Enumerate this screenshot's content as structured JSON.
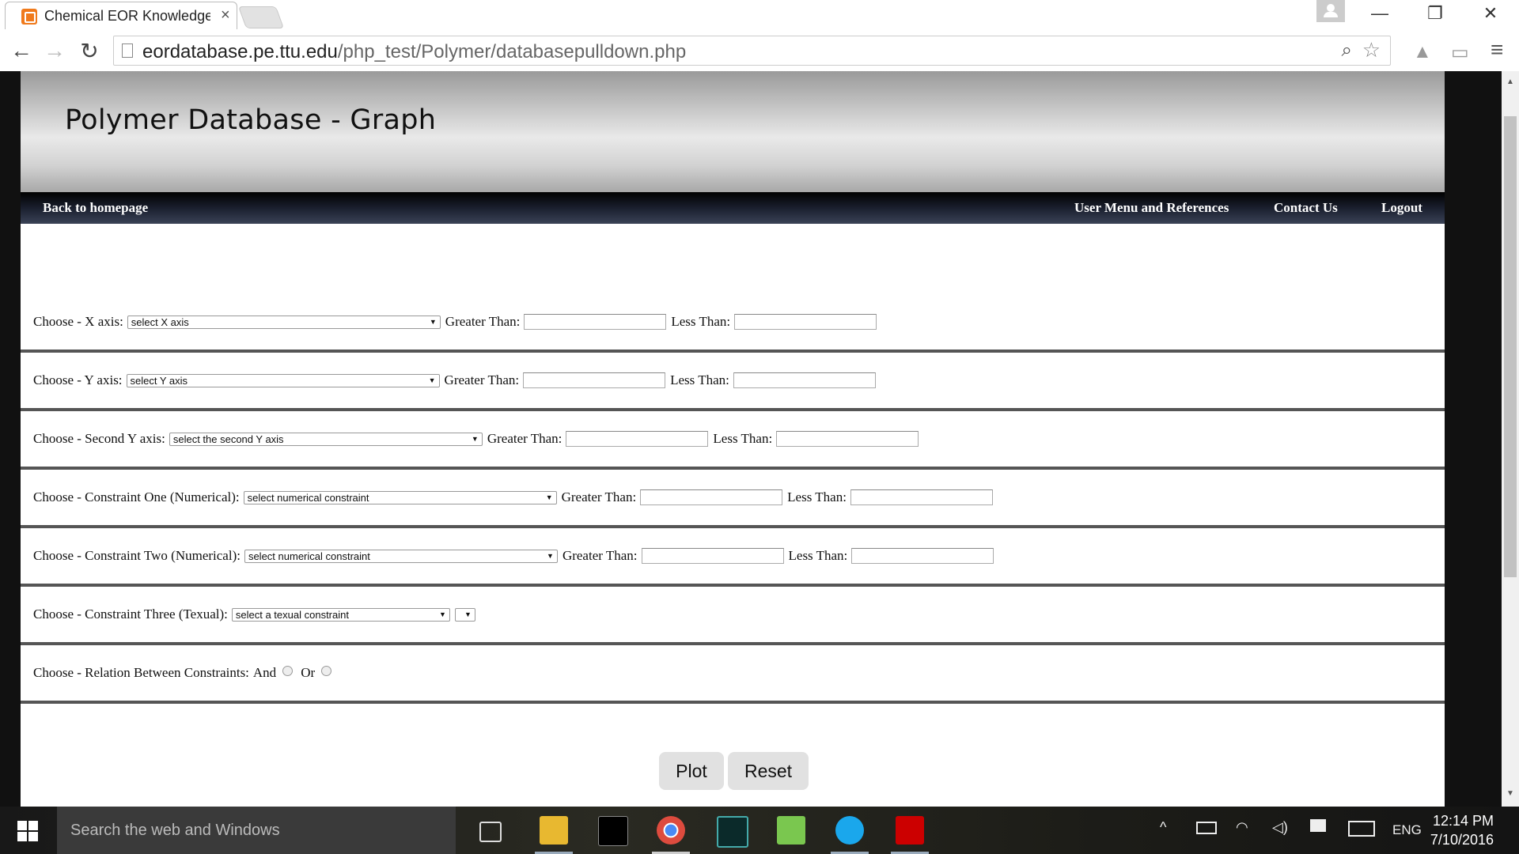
{
  "browser": {
    "tab_title": "Chemical EOR Knowledge",
    "tab_close": "×",
    "url_host": "eordatabase.pe.ttu.edu",
    "url_path": "/php_test/Polymer/databasepulldown.php",
    "window_controls": {
      "minimize": "—",
      "restore": "❐",
      "close": "✕"
    },
    "nav": {
      "back": "←",
      "forward": "→",
      "reload": "↻"
    },
    "icons": {
      "zoom": "⌕",
      "star": "☆",
      "drive": "▲",
      "cast": "▭",
      "menu": "≡"
    }
  },
  "page": {
    "title": "Polymer Database  -  Graph",
    "nav": {
      "back": "Back to homepage",
      "user_menu": "User Menu and References",
      "contact": "Contact Us",
      "logout": "Logout"
    },
    "greater_than": "Greater Than:",
    "less_than": "Less Than:",
    "rows": {
      "x_axis": {
        "label": "Choose - X axis:",
        "select": "select X axis"
      },
      "y_axis": {
        "label": "Choose - Y axis:",
        "select": "select Y axis"
      },
      "second_y": {
        "label": "Choose - Second Y axis:",
        "select": "select the second Y axis"
      },
      "constraint_one": {
        "label": "Choose - Constraint One (Numerical):",
        "select": "select numerical constraint"
      },
      "constraint_two": {
        "label": "Choose - Constraint Two (Numerical):",
        "select": "select numerical constraint"
      },
      "constraint_three": {
        "label": "Choose - Constraint Three (Texual):",
        "select": "select a texual constraint",
        "select2": ""
      },
      "relation": {
        "label": "Choose - Relation Between Constraints:",
        "and": "And",
        "or": "Or"
      }
    },
    "buttons": {
      "plot": "Plot",
      "reset": "Reset"
    }
  },
  "taskbar": {
    "search_placeholder": "Search the web and Windows",
    "language": "ENG",
    "time": "12:14 PM",
    "date": "7/10/2016"
  },
  "colors": {
    "accent_orange": "#f07a1c",
    "menubar": "#1a1f2e"
  }
}
